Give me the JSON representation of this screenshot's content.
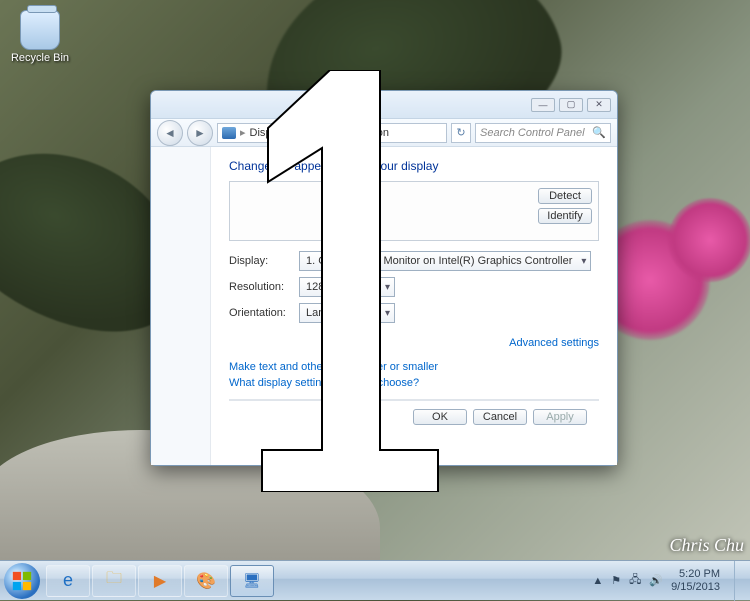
{
  "desktop": {
    "recycle_bin_label": "Recycle Bin",
    "watermark": "Chris Chu"
  },
  "window": {
    "breadcrumb": [
      "Display",
      "Screen Resolution"
    ],
    "search_placeholder": "Search Control Panel",
    "heading": "Change the appearance of your display",
    "detect_label": "Detect",
    "identify_label": "Identify",
    "labels": {
      "display": "Display:",
      "resolution": "Resolution:",
      "orientation": "Orientation:"
    },
    "values": {
      "display": "1. Generic PnP Monitor on Intel(R) Graphics Controller",
      "resolution": "1280 × 1024",
      "orientation": "Landscape"
    },
    "advanced_link": "Advanced settings",
    "link1": "Make text and other items larger or smaller",
    "link2": "What display settings should I choose?",
    "buttons": {
      "ok": "OK",
      "cancel": "Cancel",
      "apply": "Apply"
    }
  },
  "taskbar": {
    "time": "5:20 PM",
    "date": "9/15/2013"
  }
}
